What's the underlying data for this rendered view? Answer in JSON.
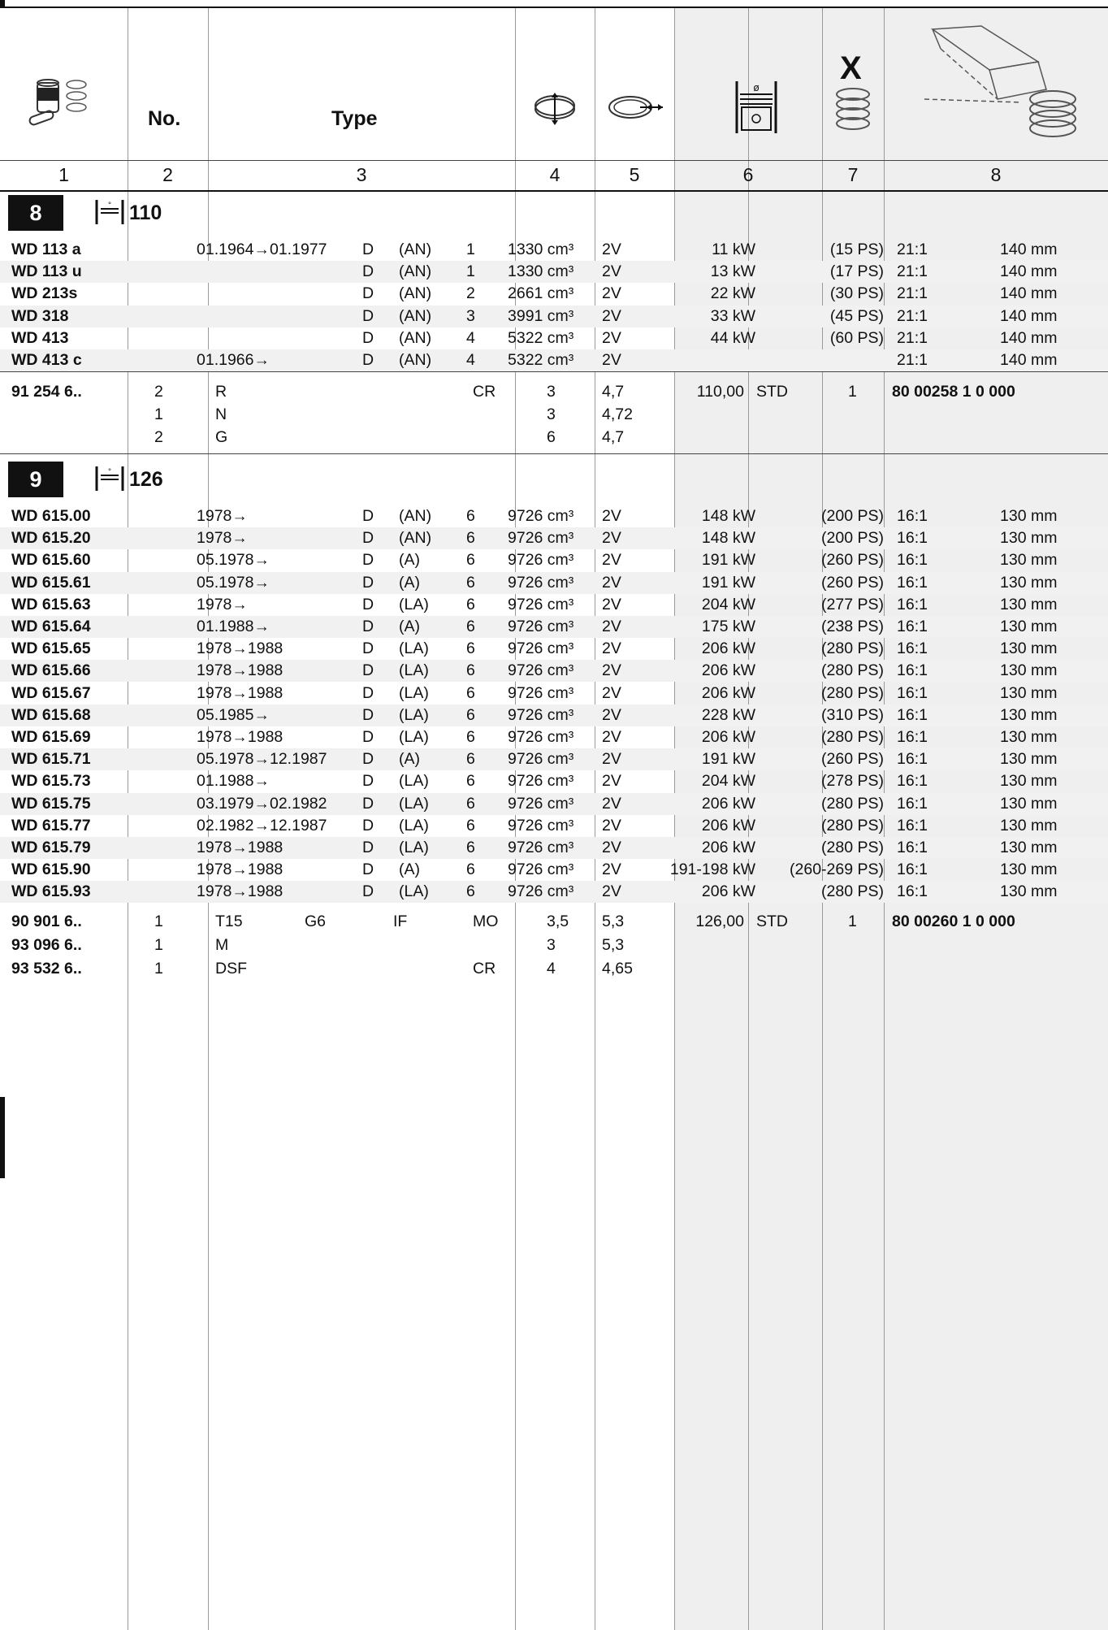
{
  "header": {
    "col_labels": [
      "1",
      "2",
      "3",
      "4",
      "5",
      "6",
      "7",
      "8"
    ],
    "no_label": "No.",
    "type_label": "Type",
    "icons": [
      "piston-set-icon",
      "ring-height-icon",
      "ring-radial-icon",
      "bore-diameter-icon",
      "quantity-rings-icon",
      "packaging-icon"
    ],
    "x_mark": "X"
  },
  "sections": [
    {
      "badge": "8",
      "bore": "110",
      "engines": [
        {
          "name": "WD 113 a",
          "date": "01.1964→01.1977",
          "fuel": "D",
          "asp": "(AN)",
          "cyl": "1",
          "ccm": "1330 cm³",
          "valves": "2V",
          "kw": "11 kW",
          "ps": "(15 PS)",
          "comp": "21:1",
          "stroke": "140 mm"
        },
        {
          "name": "WD 113 u",
          "date": "",
          "fuel": "D",
          "asp": "(AN)",
          "cyl": "1",
          "ccm": "1330 cm³",
          "valves": "2V",
          "kw": "13 kW",
          "ps": "(17 PS)",
          "comp": "21:1",
          "stroke": "140 mm"
        },
        {
          "name": "WD 213s",
          "date": "",
          "fuel": "D",
          "asp": "(AN)",
          "cyl": "2",
          "ccm": "2661 cm³",
          "valves": "2V",
          "kw": "22 kW",
          "ps": "(30 PS)",
          "comp": "21:1",
          "stroke": "140 mm"
        },
        {
          "name": "WD 318",
          "date": "",
          "fuel": "D",
          "asp": "(AN)",
          "cyl": "3",
          "ccm": "3991 cm³",
          "valves": "2V",
          "kw": "33 kW",
          "ps": "(45 PS)",
          "comp": "21:1",
          "stroke": "140 mm"
        },
        {
          "name": "WD 413",
          "date": "",
          "fuel": "D",
          "asp": "(AN)",
          "cyl": "4",
          "ccm": "5322 cm³",
          "valves": "2V",
          "kw": "44 kW",
          "ps": "(60 PS)",
          "comp": "21:1",
          "stroke": "140 mm"
        },
        {
          "name": "WD 413 c",
          "date": "01.1966→",
          "fuel": "D",
          "asp": "(AN)",
          "cyl": "4",
          "ccm": "5322 cm³",
          "valves": "2V",
          "kw": "",
          "ps": "",
          "comp": "21:1",
          "stroke": "140 mm"
        }
      ],
      "parts": [
        {
          "no": "91 254 6..",
          "qty": "2",
          "t1": "R",
          "t2": "",
          "t3": "",
          "t4": "CR",
          "h": "3",
          "r": "4,7",
          "d": "110,00",
          "std": "STD",
          "q7": "1",
          "art": "80 00258 1 0 000"
        },
        {
          "no": "",
          "qty": "1",
          "t1": "N",
          "t2": "",
          "t3": "",
          "t4": "",
          "h": "3",
          "r": "4,72",
          "d": "",
          "std": "",
          "q7": "",
          "art": ""
        },
        {
          "no": "",
          "qty": "2",
          "t1": "G",
          "t2": "",
          "t3": "",
          "t4": "",
          "h": "6",
          "r": "4,7",
          "d": "",
          "std": "",
          "q7": "",
          "art": ""
        }
      ]
    },
    {
      "badge": "9",
      "bore": "126",
      "engines": [
        {
          "name": "WD 615.00",
          "date": "1978→",
          "fuel": "D",
          "asp": "(AN)",
          "cyl": "6",
          "ccm": "9726 cm³",
          "valves": "2V",
          "kw": "148 kW",
          "ps": "(200 PS)",
          "comp": "16:1",
          "stroke": "130 mm"
        },
        {
          "name": "WD 615.20",
          "date": "1978→",
          "fuel": "D",
          "asp": "(AN)",
          "cyl": "6",
          "ccm": "9726 cm³",
          "valves": "2V",
          "kw": "148 kW",
          "ps": "(200 PS)",
          "comp": "16:1",
          "stroke": "130 mm"
        },
        {
          "name": "WD 615.60",
          "date": "05.1978→",
          "fuel": "D",
          "asp": "(A)",
          "cyl": "6",
          "ccm": "9726 cm³",
          "valves": "2V",
          "kw": "191 kW",
          "ps": "(260 PS)",
          "comp": "16:1",
          "stroke": "130 mm"
        },
        {
          "name": "WD 615.61",
          "date": "05.1978→",
          "fuel": "D",
          "asp": "(A)",
          "cyl": "6",
          "ccm": "9726 cm³",
          "valves": "2V",
          "kw": "191 kW",
          "ps": "(260 PS)",
          "comp": "16:1",
          "stroke": "130 mm"
        },
        {
          "name": "WD 615.63",
          "date": "1978→",
          "fuel": "D",
          "asp": "(LA)",
          "cyl": "6",
          "ccm": "9726 cm³",
          "valves": "2V",
          "kw": "204 kW",
          "ps": "(277 PS)",
          "comp": "16:1",
          "stroke": "130 mm"
        },
        {
          "name": "WD 615.64",
          "date": "01.1988→",
          "fuel": "D",
          "asp": "(A)",
          "cyl": "6",
          "ccm": "9726 cm³",
          "valves": "2V",
          "kw": "175 kW",
          "ps": "(238 PS)",
          "comp": "16:1",
          "stroke": "130 mm"
        },
        {
          "name": "WD 615.65",
          "date": "1978→1988",
          "fuel": "D",
          "asp": "(LA)",
          "cyl": "6",
          "ccm": "9726 cm³",
          "valves": "2V",
          "kw": "206 kW",
          "ps": "(280 PS)",
          "comp": "16:1",
          "stroke": "130 mm"
        },
        {
          "name": "WD 615.66",
          "date": "1978→1988",
          "fuel": "D",
          "asp": "(LA)",
          "cyl": "6",
          "ccm": "9726 cm³",
          "valves": "2V",
          "kw": "206 kW",
          "ps": "(280 PS)",
          "comp": "16:1",
          "stroke": "130 mm"
        },
        {
          "name": "WD 615.67",
          "date": "1978→1988",
          "fuel": "D",
          "asp": "(LA)",
          "cyl": "6",
          "ccm": "9726 cm³",
          "valves": "2V",
          "kw": "206 kW",
          "ps": "(280 PS)",
          "comp": "16:1",
          "stroke": "130 mm"
        },
        {
          "name": "WD 615.68",
          "date": "05.1985→",
          "fuel": "D",
          "asp": "(LA)",
          "cyl": "6",
          "ccm": "9726 cm³",
          "valves": "2V",
          "kw": "228 kW",
          "ps": "(310 PS)",
          "comp": "16:1",
          "stroke": "130 mm"
        },
        {
          "name": "WD 615.69",
          "date": "1978→1988",
          "fuel": "D",
          "asp": "(LA)",
          "cyl": "6",
          "ccm": "9726 cm³",
          "valves": "2V",
          "kw": "206 kW",
          "ps": "(280 PS)",
          "comp": "16:1",
          "stroke": "130 mm"
        },
        {
          "name": "WD 615.71",
          "date": "05.1978→12.1987",
          "fuel": "D",
          "asp": "(A)",
          "cyl": "6",
          "ccm": "9726 cm³",
          "valves": "2V",
          "kw": "191 kW",
          "ps": "(260 PS)",
          "comp": "16:1",
          "stroke": "130 mm"
        },
        {
          "name": "WD 615.73",
          "date": "01.1988→",
          "fuel": "D",
          "asp": "(LA)",
          "cyl": "6",
          "ccm": "9726 cm³",
          "valves": "2V",
          "kw": "204 kW",
          "ps": "(278 PS)",
          "comp": "16:1",
          "stroke": "130 mm"
        },
        {
          "name": "WD 615.75",
          "date": "03.1979→02.1982",
          "fuel": "D",
          "asp": "(LA)",
          "cyl": "6",
          "ccm": "9726 cm³",
          "valves": "2V",
          "kw": "206 kW",
          "ps": "(280 PS)",
          "comp": "16:1",
          "stroke": "130 mm"
        },
        {
          "name": "WD 615.77",
          "date": "02.1982→12.1987",
          "fuel": "D",
          "asp": "(LA)",
          "cyl": "6",
          "ccm": "9726 cm³",
          "valves": "2V",
          "kw": "206 kW",
          "ps": "(280 PS)",
          "comp": "16:1",
          "stroke": "130 mm"
        },
        {
          "name": "WD 615.79",
          "date": "1978→1988",
          "fuel": "D",
          "asp": "(LA)",
          "cyl": "6",
          "ccm": "9726 cm³",
          "valves": "2V",
          "kw": "206 kW",
          "ps": "(280 PS)",
          "comp": "16:1",
          "stroke": "130 mm"
        },
        {
          "name": "WD 615.90",
          "date": "1978→1988",
          "fuel": "D",
          "asp": "(A)",
          "cyl": "6",
          "ccm": "9726 cm³",
          "valves": "2V",
          "kw": "191-198 kW",
          "ps": "(260-269 PS)",
          "comp": "16:1",
          "stroke": "130 mm"
        },
        {
          "name": "WD 615.93",
          "date": "1978→1988",
          "fuel": "D",
          "asp": "(LA)",
          "cyl": "6",
          "ccm": "9726 cm³",
          "valves": "2V",
          "kw": "206 kW",
          "ps": "(280 PS)",
          "comp": "16:1",
          "stroke": "130 mm"
        }
      ],
      "parts": [
        {
          "no": "90 901 6..",
          "qty": "1",
          "t1": "T15",
          "t2": "G6",
          "t3": "IF",
          "t4": "MO",
          "h": "3,5",
          "r": "5,3",
          "d": "126,00",
          "std": "STD",
          "q7": "1",
          "art": "80 00260 1 0 000"
        },
        {
          "no": "93 096 6..",
          "qty": "1",
          "t1": "M",
          "t2": "",
          "t3": "",
          "t4": "",
          "h": "3",
          "r": "5,3",
          "d": "",
          "std": "",
          "q7": "",
          "art": ""
        },
        {
          "no": "93 532 6..",
          "qty": "1",
          "t1": "DSF",
          "t2": "",
          "t3": "",
          "t4": "CR",
          "h": "4",
          "r": "4,65",
          "d": "",
          "std": "",
          "q7": "",
          "art": ""
        }
      ]
    }
  ]
}
